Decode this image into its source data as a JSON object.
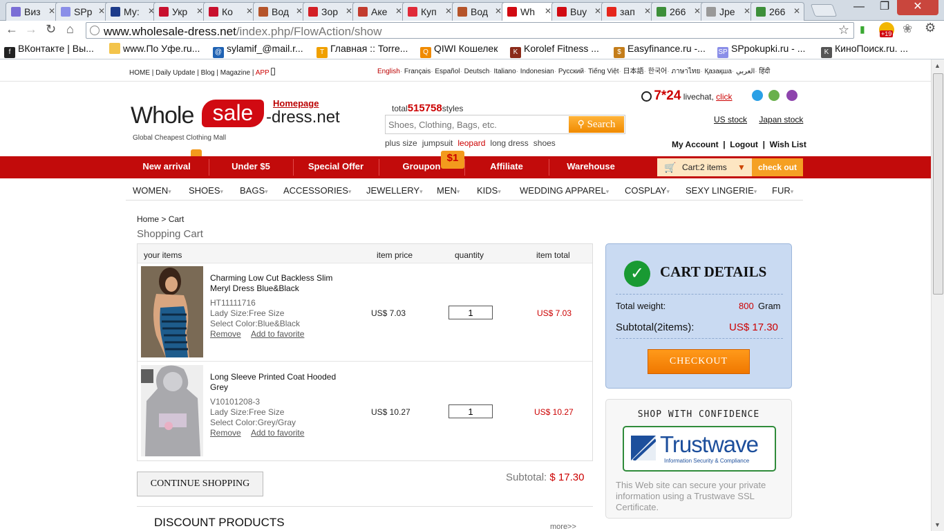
{
  "browser": {
    "tabs": [
      {
        "title": "Виз",
        "icon_color": "#7a6ed6",
        "icon": "grid-icon",
        "active": false
      },
      {
        "title": "SPр",
        "icon_color": "#8a8ee8",
        "icon": "sp-icon",
        "active": false
      },
      {
        "title": "Му:",
        "icon_color": "#1d3b8a",
        "icon": "clock-icon",
        "active": false
      },
      {
        "title": "Укр",
        "icon_color": "#c8102e",
        "icon": "bird-icon",
        "active": false
      },
      {
        "title": "Ко",
        "icon_color": "#c8102e",
        "icon": "bird-icon",
        "active": false
      },
      {
        "title": "Вод",
        "icon_color": "#b5542a",
        "icon": "face-icon",
        "active": false
      },
      {
        "title": "Зор",
        "icon_color": "#d31f26",
        "icon": "z-icon",
        "active": false
      },
      {
        "title": "Аке",
        "icon_color": "#c23b2e",
        "icon": "arrow-icon",
        "active": false
      },
      {
        "title": "Куп",
        "icon_color": "#e02a39",
        "icon": "coupon-icon",
        "active": false
      },
      {
        "title": "Вод",
        "icon_color": "#b5542a",
        "icon": "face-icon",
        "active": false
      },
      {
        "title": "Wh",
        "icon_color": "#d10a12",
        "icon": "w-icon",
        "active": true
      },
      {
        "title": "Buy",
        "icon_color": "#d10a12",
        "icon": "w-icon",
        "active": false
      },
      {
        "title": "зап",
        "icon_color": "#e5261c",
        "icon": "yandex-icon",
        "active": false
      },
      {
        "title": "266",
        "icon_color": "#3d8f3a",
        "icon": "image-icon",
        "active": false
      },
      {
        "title": "Jре",
        "icon_color": "#999999",
        "icon": "globe-icon",
        "active": false
      },
      {
        "title": "266",
        "icon_color": "#3d8f3a",
        "icon": "image-icon",
        "active": false
      }
    ],
    "url_host": "www.wholesale-dress.net",
    "url_path": "/index.php/FlowAction/show",
    "badge": "+19",
    "bookmarks": [
      {
        "label": "ВКонтакте | Вы...",
        "icon_color": "#222222",
        "icon": "f"
      },
      {
        "label": "www.По Уфе.ru...",
        "icon_color": "#f3c44b",
        "icon": ""
      },
      {
        "label": "sylamif_@mail.r...",
        "icon_color": "#1f62b3",
        "icon": "@"
      },
      {
        "label": "Главная :: Torre...",
        "icon_color": "#f0a000",
        "icon": "T"
      },
      {
        "label": "QIWI Кошелек",
        "icon_color": "#f08a00",
        "icon": "Q"
      },
      {
        "label": "Korolef Fitness ...",
        "icon_color": "#8b2b1a",
        "icon": "K"
      },
      {
        "label": "Easyfinance.ru -...",
        "icon_color": "#c47d1a",
        "icon": "$"
      },
      {
        "label": "SPpokupki.ru - ...",
        "icon_color": "#8a8ee8",
        "icon": "SP"
      },
      {
        "label": "КиноПоиск.ru. ...",
        "icon_color": "#555555",
        "icon": "K"
      }
    ]
  },
  "site": {
    "top_links": [
      "HOME",
      "Daily Update",
      "Blog",
      "Magazine",
      "APP"
    ],
    "languages": [
      "English",
      "Français",
      "Español",
      "Deutsch",
      "Italiano",
      "Indonesian",
      "Русский",
      "Tiếng Việt",
      "日本語",
      "한국어",
      "ภาษาไทย",
      "Қазақша",
      "العربي",
      "हिंदी"
    ],
    "logo": {
      "part1": "Whole",
      "part2": "sale",
      "part3": "-dress.net",
      "tagline": "Global Cheapest Clothing Mall"
    },
    "homepage_link": "Homepage",
    "total_label": "total",
    "total_count": "515758",
    "total_suffix": "styles",
    "search_placeholder": "Shoes, Clothing, Bags, etc.",
    "search_button": "Search",
    "hot_words": [
      "plus size",
      "jumpsuit",
      "leopard",
      "long dress",
      "shoes"
    ],
    "livechat_hours": "7*24",
    "livechat_label": "livechat,",
    "livechat_link": "click",
    "stocks": [
      "US stock",
      "Japan stock"
    ],
    "account_links": [
      "My Account",
      "Logout",
      "Wish List"
    ]
  },
  "red_nav": {
    "items": [
      "New arrival",
      "Under $5",
      "Special Offer",
      "Groupon",
      "Affiliate",
      "Warehouse"
    ],
    "groupon_badge": "$1",
    "cart_label": "Cart:",
    "cart_count": "2",
    "cart_items_word": "items",
    "checkout": "check out"
  },
  "categories": [
    "WOMEN",
    "SHOES",
    "BAGS",
    "ACCESSORIES",
    "JEWELLERY",
    "MEN",
    "KIDS",
    "WEDDING APPAREL",
    "COSPLAY",
    "SEXY LINGERIE",
    "FUR"
  ],
  "cart": {
    "breadcrumb_home": "Home",
    "breadcrumb_current": "Cart",
    "title": "Shopping Cart",
    "columns": [
      "your items",
      "item price",
      "quantity",
      "item total"
    ],
    "items": [
      {
        "name": "Charming Low Cut Backless Slim Meryl Dress Blue&Black",
        "sku": "HT11111716",
        "size": "Lady Size:Free Size",
        "color": "Select Color:Blue&Black",
        "remove": "Remove",
        "favorite": "Add to favorite",
        "price": "US$ 7.03",
        "quantity": "1",
        "total": "US$ 7.03"
      },
      {
        "name": "Long Sleeve Printed Coat Hooded Grey",
        "sku": "V10101208-3",
        "size": "Lady Size:Free Size",
        "color": "Select Color:Grey/Gray",
        "remove": "Remove",
        "favorite": "Add to favorite",
        "price": "US$ 10.27",
        "quantity": "1",
        "total": "US$ 10.27"
      }
    ],
    "subtotal_label": "Subtotal:",
    "subtotal_value": "$ 17.30",
    "continue_button": "CONTINUE SHOPPING",
    "discount_title": "DISCOUNT PRODUCTS",
    "more_link": "more>>"
  },
  "details": {
    "title": "CART DETAILS",
    "weight_label": "Total weight:",
    "weight_value": "800",
    "weight_unit": "Gram",
    "subtotal_label": "Subtotal(2items):",
    "subtotal_value": "US$ 17.30",
    "checkout_button": "CHECKOUT"
  },
  "confidence": {
    "title": "SHOP WITH CONFIDENCE",
    "brand": "Trustwave",
    "brand_sub": "Information Security & Compliance",
    "description": "This Web site can secure your private information using a Trustwave SSL Certificate."
  }
}
